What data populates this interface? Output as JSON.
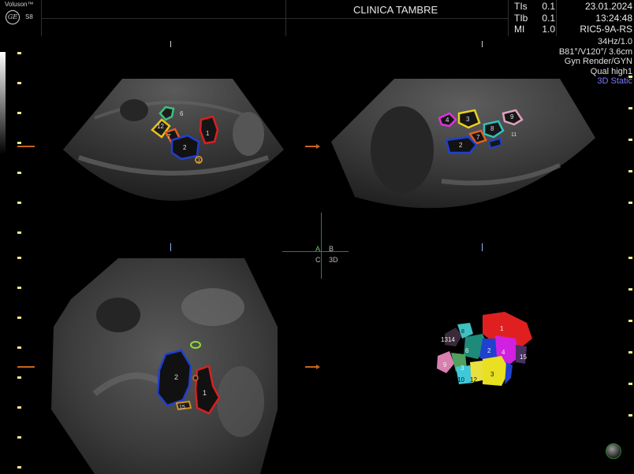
{
  "header": {
    "brand": "Voluson™",
    "logo_glyph": "GE",
    "model": "S8",
    "clinic": "CLINICA TAMBRE",
    "indices": [
      {
        "label": "TIs",
        "value": "0.1"
      },
      {
        "label": "TIb",
        "value": "0.1"
      },
      {
        "label": "MI",
        "value": "1.0"
      }
    ],
    "date": "23.01.2024",
    "time": "13:24:48",
    "probe": "RIC5-9A-RS"
  },
  "params": {
    "frame_rate": "34Hz/1.0",
    "angles": "B81°/V120°/ 3.6cm",
    "render": "Gyn Render/GYN",
    "quality": "Qual high1",
    "mode": "3D Static"
  },
  "quad_selector": {
    "a": "A",
    "b": "B",
    "c": "C",
    "d": "3D"
  },
  "panels": {
    "a_labels": [
      "6",
      "12",
      "7",
      "1",
      "2",
      "3"
    ],
    "b_labels": [
      "4",
      "3",
      "9",
      "8",
      "7",
      "2",
      "11"
    ],
    "c_labels": [
      "2",
      "1",
      "15"
    ],
    "render_labels": [
      "1",
      "13",
      "14",
      "8",
      "6",
      "2",
      "4",
      "15",
      "9",
      "3",
      "10",
      "12",
      "3"
    ]
  },
  "colors": {
    "orange_marker": "#c8641e",
    "quad_active": "#6cc46c",
    "accent_blue": "#7b7bff"
  }
}
